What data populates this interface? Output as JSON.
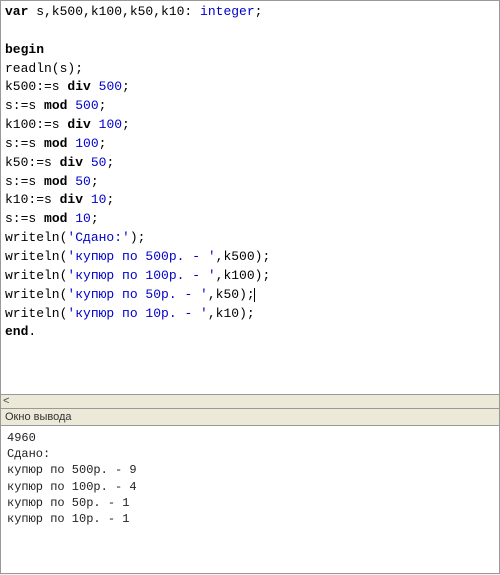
{
  "code": {
    "line1_var": "var",
    "line1_decl": " s,k500,k100,k50,k10: ",
    "line1_type": "integer",
    "line1_end": ";",
    "line2": "",
    "line3_begin": "begin",
    "line4": "readln(s);",
    "line5a": "k500:=s ",
    "line5b": "div",
    "line5c": " ",
    "line5d": "500",
    "line5e": ";",
    "line6a": "s:=s ",
    "line6b": "mod",
    "line6c": " ",
    "line6d": "500",
    "line6e": ";",
    "line7a": "k100:=s ",
    "line7b": "div",
    "line7c": " ",
    "line7d": "100",
    "line7e": ";",
    "line8a": "s:=s ",
    "line8b": "mod",
    "line8c": " ",
    "line8d": "100",
    "line8e": ";",
    "line9a": "k50:=s ",
    "line9b": "div",
    "line9c": " ",
    "line9d": "50",
    "line9e": ";",
    "line10a": "s:=s ",
    "line10b": "mod",
    "line10c": " ",
    "line10d": "50",
    "line10e": ";",
    "line11a": "k10:=s ",
    "line11b": "div",
    "line11c": " ",
    "line11d": "10",
    "line11e": ";",
    "line12a": "s:=s ",
    "line12b": "mod",
    "line12c": " ",
    "line12d": "10",
    "line12e": ";",
    "line13a": "writeln(",
    "line13b": "'Сдано:'",
    "line13c": ");",
    "line14a": "writeln(",
    "line14b": "'купюр по 500р. - '",
    "line14c": ",k500);",
    "line15a": "writeln(",
    "line15b": "'купюр по 100р. - '",
    "line15c": ",k100);",
    "line16a": "writeln(",
    "line16b": "'купюр по 50р. - '",
    "line16c": ",k50);",
    "line17a": "writeln(",
    "line17b": "'купюр по 10р. - '",
    "line17c": ",k10);",
    "line18_end": "end",
    "line18_dot": "."
  },
  "splitter_label": "<",
  "output_title": "Окно вывода",
  "output": {
    "l1": "4960",
    "l2": "Сдано:",
    "l3": "купюр по 500р. - 9",
    "l4": "купюр по 100р. - 4",
    "l5": "купюр по 50р. - 1",
    "l6": "купюр по 10р. - 1"
  }
}
